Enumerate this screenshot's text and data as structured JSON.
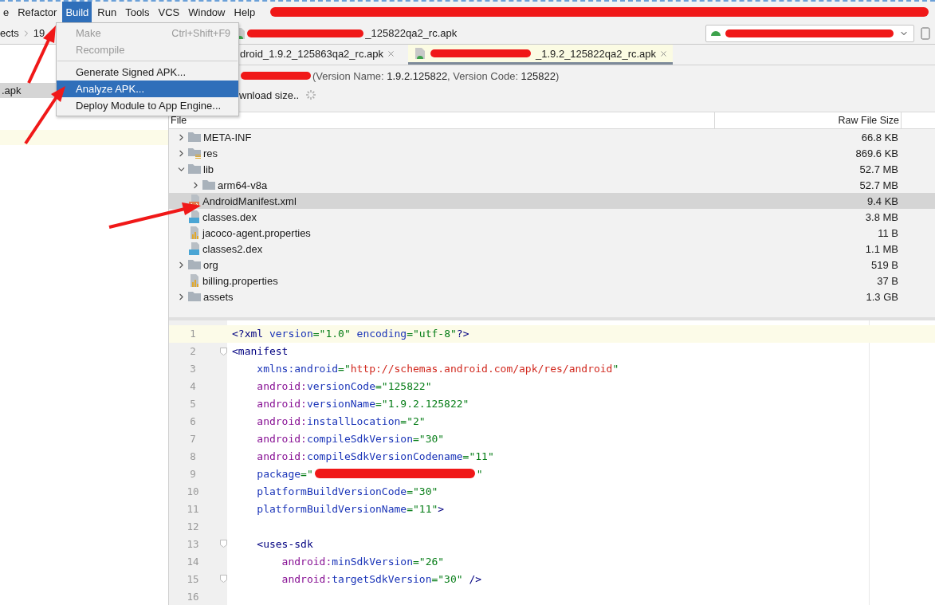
{
  "menubar": {
    "items": [
      {
        "label": "e",
        "selected": false
      },
      {
        "label": "Refactor",
        "selected": false
      },
      {
        "label": "Build",
        "selected": true
      },
      {
        "label": "Run",
        "selected": false
      },
      {
        "label": "Tools",
        "selected": false
      },
      {
        "label": "VCS",
        "selected": false
      },
      {
        "label": "Window",
        "selected": false
      },
      {
        "label": "Help",
        "selected": false
      }
    ],
    "redacted": true
  },
  "build_menu": {
    "items": [
      {
        "kind": "item",
        "label": "Make",
        "shortcut": "Ctrl+Shift+F9",
        "disabled": true,
        "selected": false
      },
      {
        "kind": "item",
        "label": "Recompile",
        "disabled": true,
        "selected": false
      },
      {
        "kind": "separator"
      },
      {
        "kind": "item",
        "label": "Generate Signed APK...",
        "disabled": false,
        "selected": false
      },
      {
        "kind": "item",
        "label": "Analyze APK...",
        "disabled": false,
        "selected": true
      },
      {
        "kind": "item",
        "label": "Deploy Module to App Engine...",
        "disabled": false,
        "selected": false
      }
    ]
  },
  "navbar": {
    "breadcrumbs": [
      "ects",
      "19"
    ],
    "file": {
      "label": "_125822qa2_rc.apk",
      "redacted": true
    },
    "device_selector": {
      "redacted": true
    }
  },
  "project_panel": {
    "rows": [
      {
        "label": ".apk",
        "selected": true,
        "current": false
      },
      {
        "selected": false,
        "current": true
      }
    ]
  },
  "tabs": [
    {
      "label": "droid_1.9.2_125863qa2_rc.apk",
      "selected": false,
      "redacted": false
    },
    {
      "label": "_1.9.2_125822qa2_rc.apk",
      "selected": true,
      "redacted": true
    }
  ],
  "apk_info": {
    "redacted": true,
    "text": "(Version Name: **1.9.2.125822**, Version Code: **125822**)",
    "download_size": "wnload size..",
    "loading": true
  },
  "table": {
    "columns": [
      "File",
      "Raw File Size"
    ],
    "rows": [
      {
        "name": "META-INF",
        "kind": "folder",
        "size": "66.8 KB",
        "expanded": false,
        "selected": false
      },
      {
        "name": "res",
        "kind": "res-folder",
        "size": "869.6 KB",
        "expanded": false,
        "selected": false
      },
      {
        "name": "lib",
        "kind": "folder",
        "size": "52.7 MB",
        "expanded": true,
        "selected": false,
        "children": [
          {
            "name": "arm64-v8a",
            "kind": "folder",
            "size": "52.7 MB",
            "expanded": false,
            "selected": false
          }
        ]
      },
      {
        "name": "AndroidManifest.xml",
        "kind": "xml",
        "size": "9.4 KB",
        "selected": true
      },
      {
        "name": "classes.dex",
        "kind": "dex",
        "size": "3.8 MB",
        "selected": false
      },
      {
        "name": "jacoco-agent.properties",
        "kind": "properties",
        "size": "11 B",
        "selected": false
      },
      {
        "name": "classes2.dex",
        "kind": "dex",
        "size": "1.1 MB",
        "selected": false
      },
      {
        "name": "org",
        "kind": "folder",
        "size": "519 B",
        "expanded": false,
        "selected": false
      },
      {
        "name": "billing.properties",
        "kind": "properties",
        "size": "37 B",
        "selected": false
      },
      {
        "name": "assets",
        "kind": "folder",
        "size": "1.3 GB",
        "expanded": false,
        "selected": false
      }
    ]
  },
  "editor": {
    "lines": [
      {
        "number": "1",
        "current": true,
        "tokens": [
          {
            "kind": "tag",
            "text": "<?xml "
          },
          {
            "kind": "attr",
            "text": "version"
          },
          {
            "kind": "value",
            "text": "=\"1.0\" "
          },
          {
            "kind": "attr",
            "text": "encoding"
          },
          {
            "kind": "value",
            "text": "=\"utf-8\""
          },
          {
            "kind": "tag",
            "text": "?>"
          }
        ]
      },
      {
        "number": "2",
        "current": false,
        "fold": true,
        "tokens": [
          {
            "kind": "tag",
            "text": "<manifest"
          }
        ]
      },
      {
        "number": "3",
        "current": false,
        "tokens": [
          {
            "kind": "attr",
            "text": "    xmlns:android"
          },
          {
            "kind": "value",
            "text": "=\""
          },
          {
            "kind": "url",
            "text": "http://schemas.android.com/apk/res/android"
          },
          {
            "kind": "value",
            "text": "\""
          }
        ]
      },
      {
        "number": "4",
        "current": false,
        "tokens": [
          {
            "kind": "ns",
            "text": "    android:"
          },
          {
            "kind": "attr",
            "text": "versionCode"
          },
          {
            "kind": "value",
            "text": "=\"125822\""
          }
        ]
      },
      {
        "number": "5",
        "current": false,
        "tokens": [
          {
            "kind": "ns",
            "text": "    android:"
          },
          {
            "kind": "attr",
            "text": "versionName"
          },
          {
            "kind": "value",
            "text": "=\"1.9.2.125822\""
          }
        ]
      },
      {
        "number": "6",
        "current": false,
        "tokens": [
          {
            "kind": "ns",
            "text": "    android:"
          },
          {
            "kind": "attr",
            "text": "installLocation"
          },
          {
            "kind": "value",
            "text": "=\"2\""
          }
        ]
      },
      {
        "number": "7",
        "current": false,
        "tokens": [
          {
            "kind": "ns",
            "text": "    android:"
          },
          {
            "kind": "attr",
            "text": "compileSdkVersion"
          },
          {
            "kind": "value",
            "text": "=\"30\""
          }
        ]
      },
      {
        "number": "8",
        "current": false,
        "tokens": [
          {
            "kind": "ns",
            "text": "    android:"
          },
          {
            "kind": "attr",
            "text": "compileSdkVersionCodename"
          },
          {
            "kind": "value",
            "text": "=\"11\""
          }
        ]
      },
      {
        "number": "9",
        "current": false,
        "tokens": [
          {
            "kind": "attr",
            "text": "    package"
          },
          {
            "kind": "value",
            "text": "=\""
          },
          {
            "kind": "redacted"
          },
          {
            "kind": "value",
            "text": "\""
          }
        ]
      },
      {
        "number": "10",
        "current": false,
        "tokens": [
          {
            "kind": "attr",
            "text": "    platformBuildVersionCode"
          },
          {
            "kind": "value",
            "text": "=\"30\""
          }
        ]
      },
      {
        "number": "11",
        "current": false,
        "tokens": [
          {
            "kind": "attr",
            "text": "    platformBuildVersionName"
          },
          {
            "kind": "value",
            "text": "=\"11\""
          },
          {
            "kind": "tag",
            "text": ">"
          }
        ]
      },
      {
        "number": "12",
        "current": false
      },
      {
        "number": "13",
        "current": false,
        "fold": true,
        "tokens": [
          {
            "kind": "tag",
            "text": "    <uses-sdk"
          }
        ]
      },
      {
        "number": "14",
        "current": false,
        "tokens": [
          {
            "kind": "ns",
            "text": "        android:"
          },
          {
            "kind": "attr",
            "text": "minSdkVersion"
          },
          {
            "kind": "value",
            "text": "=\"26\""
          }
        ]
      },
      {
        "number": "15",
        "current": false,
        "fold": true,
        "tokens": [
          {
            "kind": "ns",
            "text": "        android:"
          },
          {
            "kind": "attr",
            "text": "targetSdkVersion"
          },
          {
            "kind": "value",
            "text": "=\"30\" "
          },
          {
            "kind": "tag",
            "text": "/>"
          }
        ]
      },
      {
        "number": "16",
        "current": false
      }
    ]
  }
}
